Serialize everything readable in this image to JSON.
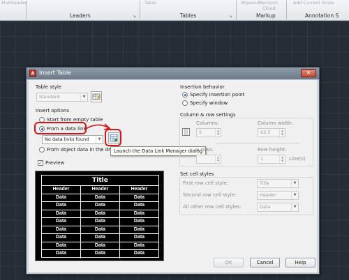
{
  "ribbon": {
    "faded_left": "Multileader",
    "faded_table": "Table",
    "faded_wipeout": "Wipeout",
    "faded_revision": "Revision",
    "faded_cloud": "Cloud",
    "faded_add_scale": "Add Current Scale",
    "panels": [
      "Leaders",
      "Tables",
      "Markup",
      "Annotation S"
    ]
  },
  "dialog": {
    "title": "Insert Table",
    "table_style": {
      "label": "Table style",
      "value": "Standard"
    },
    "insert_options": {
      "label": "Insert options",
      "empty_table": "Start from empty table",
      "data_link": "From a data link",
      "data_link_value": "No data links found",
      "object_data": "From object data in the drawing"
    },
    "tooltip": "Launch the Data Link Manager dialog",
    "preview": {
      "label": "Preview",
      "title": "Title",
      "header": [
        "Header",
        "Header",
        "Header"
      ],
      "rows": [
        [
          "Data",
          "Data",
          "Data"
        ],
        [
          "Data",
          "Data",
          "Data"
        ],
        [
          "Data",
          "Data",
          "Data"
        ],
        [
          "Data",
          "Data",
          "Data"
        ],
        [
          "Data",
          "Data",
          "Data"
        ],
        [
          "Data",
          "Data",
          "Data"
        ],
        [
          "Data",
          "Data",
          "Data"
        ],
        [
          "Data",
          "Data",
          "Data"
        ]
      ]
    },
    "insertion_behavior": {
      "label": "Insertion behavior",
      "specify_point": "Specify insertion point",
      "specify_window": "Specify window"
    },
    "column_row": {
      "label": "Column & row settings",
      "columns_label": "Columns:",
      "columns_value": "5",
      "column_width_label": "Column width:",
      "column_width_value": "63.5",
      "data_rows_label": "a rows:",
      "row_height_label": "Row height:",
      "row_height_value": "1",
      "lines_unit": "Line(s)"
    },
    "cell_styles": {
      "label": "Set cell styles",
      "first_row_label": "First row cell style:",
      "first_row_value": "Title",
      "second_row_label": "Second row cell style:",
      "second_row_value": "Header",
      "other_rows_label": "All other row cell styles:",
      "other_rows_value": "Data"
    },
    "buttons": {
      "ok": "OK",
      "cancel": "Cancel",
      "help": "Help"
    }
  },
  "colors": {
    "annotation_red": "#d8141b",
    "preview_bg": "#000000",
    "drawing_bg": "#262d36"
  }
}
